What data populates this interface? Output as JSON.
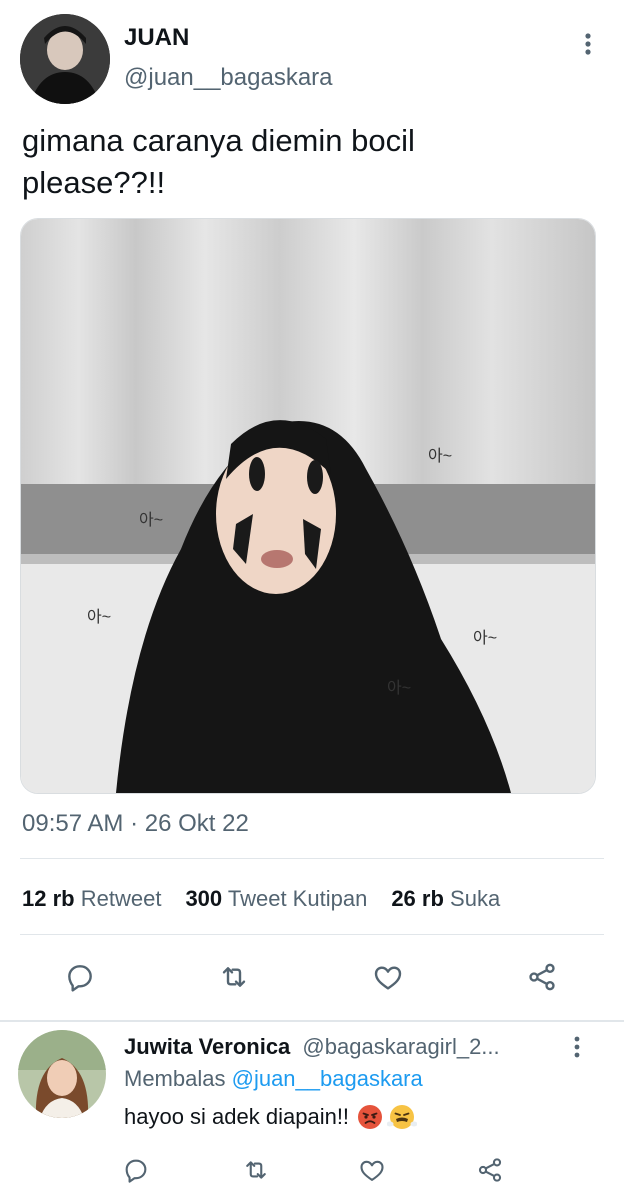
{
  "tweet": {
    "author_name": "JUAN",
    "author_handle": "@juan__bagaskara",
    "text_line1": "gimana caranya diemin bocil",
    "text_line2": "please??!!",
    "image_marks": [
      "아~",
      "아~",
      "아~",
      "아~",
      "아~"
    ],
    "time": "09:57 AM",
    "dot": "·",
    "date": "26 Okt 22"
  },
  "stats": {
    "retweets_count": "12 rb",
    "retweets_label": "Retweet",
    "quotes_count": "300",
    "quotes_label": "Tweet Kutipan",
    "likes_count": "26 rb",
    "likes_label": "Suka"
  },
  "actions": [
    "reply-icon",
    "retweet-icon",
    "like-icon",
    "share-icon"
  ],
  "reply": {
    "author_name": "Juwita Veronica",
    "author_handle": "@bagaskaragirl_2...",
    "replying_prefix": "Membalas",
    "replying_to": "@juan__bagaskara",
    "text": "hayoo si adek diapain!!",
    "emojis": [
      "angry-face",
      "steam-face"
    ]
  },
  "colors": {
    "text": "#0f1419",
    "muted": "#536471",
    "link": "#1d9bf0",
    "divider": "#e1e6ea",
    "icon": "#536471"
  }
}
